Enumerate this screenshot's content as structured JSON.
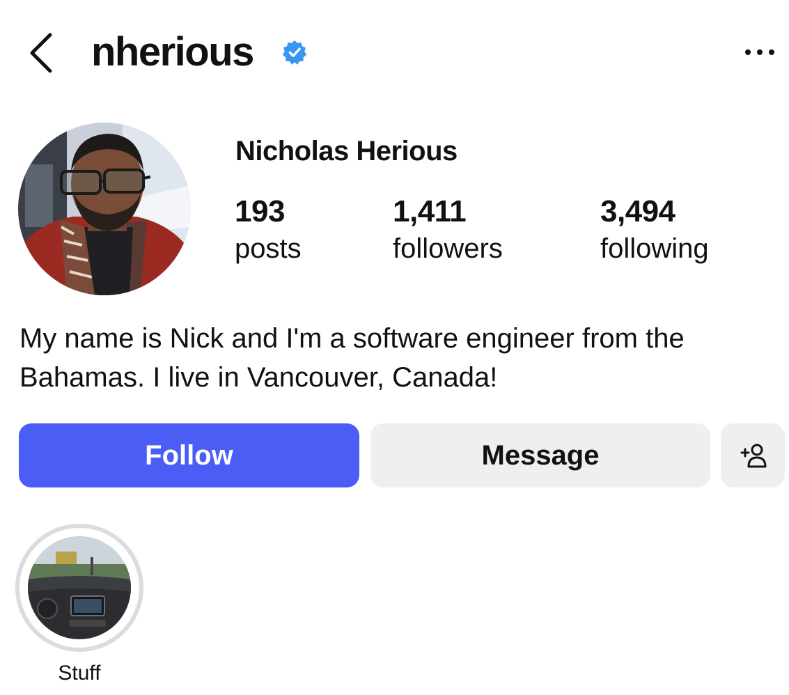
{
  "header": {
    "username": "nherious",
    "back_icon": "chevron-left-icon",
    "verified_icon": "verified-badge-icon",
    "more_icon": "more-horizontal-icon",
    "verified_color": "#3897f0"
  },
  "profile": {
    "display_name": "Nicholas Herious",
    "stats": [
      {
        "value": "193",
        "label": "posts"
      },
      {
        "value": "1,411",
        "label": "followers"
      },
      {
        "value": "3,494",
        "label": "following"
      }
    ],
    "bio": "My name is Nick and I'm a software engineer from the Bahamas. I live in Vancouver, Canada!"
  },
  "actions": {
    "follow_label": "Follow",
    "message_label": "Message",
    "suggest_icon": "add-person-icon",
    "follow_color": "#4a5df5",
    "secondary_color": "#efeff2"
  },
  "highlights": [
    {
      "label": "Stuff"
    }
  ]
}
